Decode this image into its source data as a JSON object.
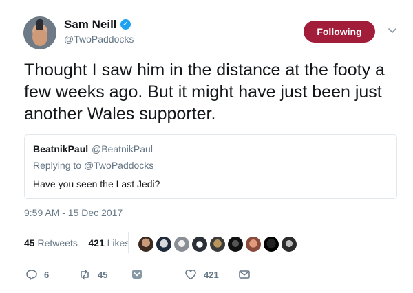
{
  "author": {
    "name": "Sam Neill",
    "handle": "@TwoPaddocks"
  },
  "follow_button": "Following",
  "tweet_text": "Thought I saw him in the distance at the footy a few weeks ago. But it might have just been just another Wales supporter.",
  "quoted_tweet": {
    "name": "BeatnikPaul",
    "handle": "@BeatnikPaul",
    "replying_prefix": "Replying to",
    "replying_to": "@TwoPaddocks",
    "text": "Have you seen the Last Jedi?"
  },
  "timestamp": "9:59 AM - 15 Dec 2017",
  "stats": {
    "retweets_count": "45",
    "retweets_label": "Retweets",
    "likes_count": "421",
    "likes_label": "Likes"
  },
  "likers_count_shown": 9,
  "actions": {
    "reply_count": "6",
    "retweet_count": "45",
    "like_count": "421"
  },
  "colors": {
    "follow_button": "#a21d3a",
    "verified": "#1da1f2",
    "secondary_text": "#657786"
  },
  "icons": [
    "verified-badge-icon",
    "chevron-down-icon",
    "reply-icon",
    "retweet-icon",
    "save-icon",
    "like-icon",
    "message-icon"
  ]
}
